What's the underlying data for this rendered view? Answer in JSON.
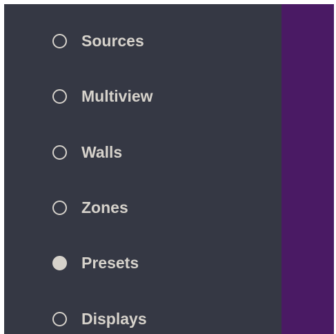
{
  "sidebar": {
    "selected_index": 4,
    "items": [
      {
        "label": "Sources"
      },
      {
        "label": "Multiview"
      },
      {
        "label": "Walls"
      },
      {
        "label": "Zones"
      },
      {
        "label": "Presets"
      },
      {
        "label": "Displays"
      }
    ]
  },
  "colors": {
    "sidebar_bg": "#353844",
    "content_bg": "#4a1a64",
    "text": "#d6d2cb"
  }
}
